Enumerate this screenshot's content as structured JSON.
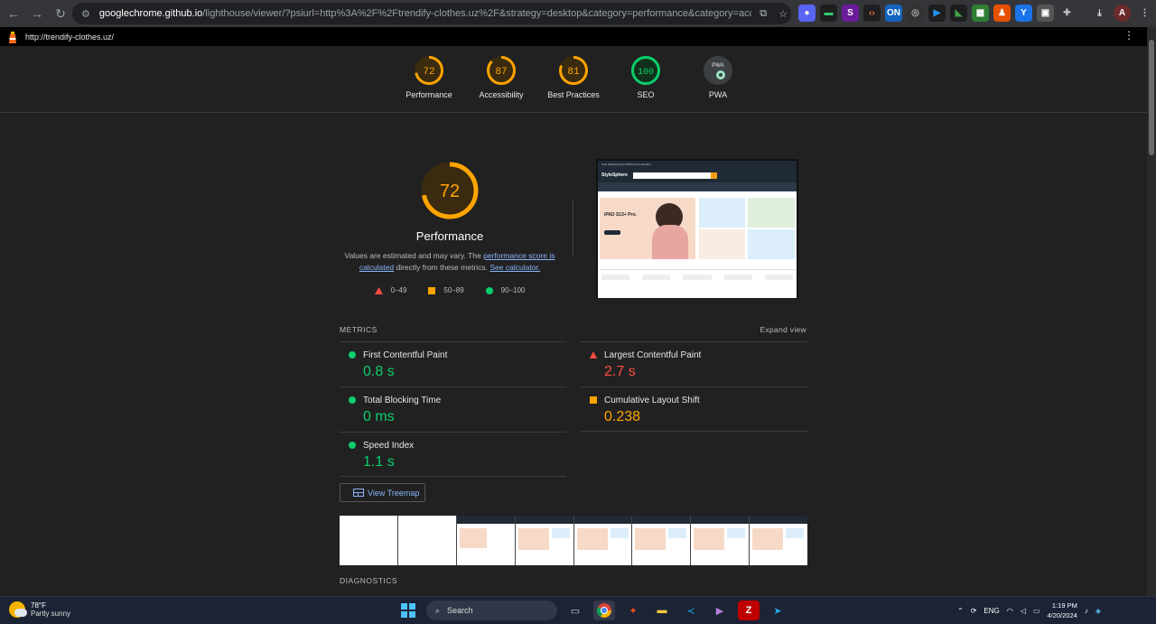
{
  "browser": {
    "url_host": "googlechrome.github.io",
    "url_rest": "/lighthouse/viewer/?psiurl=http%3A%2F%2Ftrendify-clothes.uz%2F&strategy=desktop&category=performance&category=accessibility&category=be...",
    "avatar_letter": "A"
  },
  "lighthouse_bar": {
    "url": "http://trendify-clothes.uz/"
  },
  "gauges": [
    {
      "score": "72",
      "label": "Performance",
      "color": "#ffa400"
    },
    {
      "score": "87",
      "label": "Accessibility",
      "color": "#ffa400"
    },
    {
      "score": "81",
      "label": "Best Practices",
      "color": "#ffa400"
    },
    {
      "score": "100",
      "label": "SEO",
      "color": "#0cce6b"
    },
    {
      "score": "PWA",
      "label": "PWA",
      "color": "#9aa0a6"
    }
  ],
  "performance": {
    "score": "72",
    "score_fraction": 0.72,
    "title": "Performance",
    "desc_pre": "Values are estimated and may vary. The ",
    "desc_link1": "performance score is calculated",
    "desc_mid": " directly from these metrics. ",
    "desc_link2": "See calculator.",
    "legend": [
      "0–49",
      "50–89",
      "90–100"
    ]
  },
  "screenshot": {
    "topbar": "Free Shipping Over $150 & Free Returns",
    "brand": "StyleSphere",
    "hero_title": "iPAD S13+ Pro."
  },
  "metrics": {
    "header": "METRICS",
    "expand": "Expand view",
    "left": [
      {
        "name": "First Contentful Paint",
        "value": "0.8 s",
        "status": "pass"
      },
      {
        "name": "Total Blocking Time",
        "value": "0 ms",
        "status": "pass"
      },
      {
        "name": "Speed Index",
        "value": "1.1 s",
        "status": "pass"
      }
    ],
    "right": [
      {
        "name": "Largest Contentful Paint",
        "value": "2.7 s",
        "status": "fail"
      },
      {
        "name": "Cumulative Layout Shift",
        "value": "0.238",
        "status": "average"
      }
    ]
  },
  "treemap_label": "View Treemap",
  "diagnostics": "DIAGNOSTICS",
  "colors": {
    "pass": "#0cce6b",
    "average": "#ffa400",
    "fail": "#ff4e42",
    "link": "#8ab4f8"
  },
  "taskbar": {
    "temp": "78°F",
    "weather": "Partly sunny",
    "search": "Search",
    "lang": "ENG",
    "time": "1:19 PM",
    "date": "4/20/2024"
  }
}
